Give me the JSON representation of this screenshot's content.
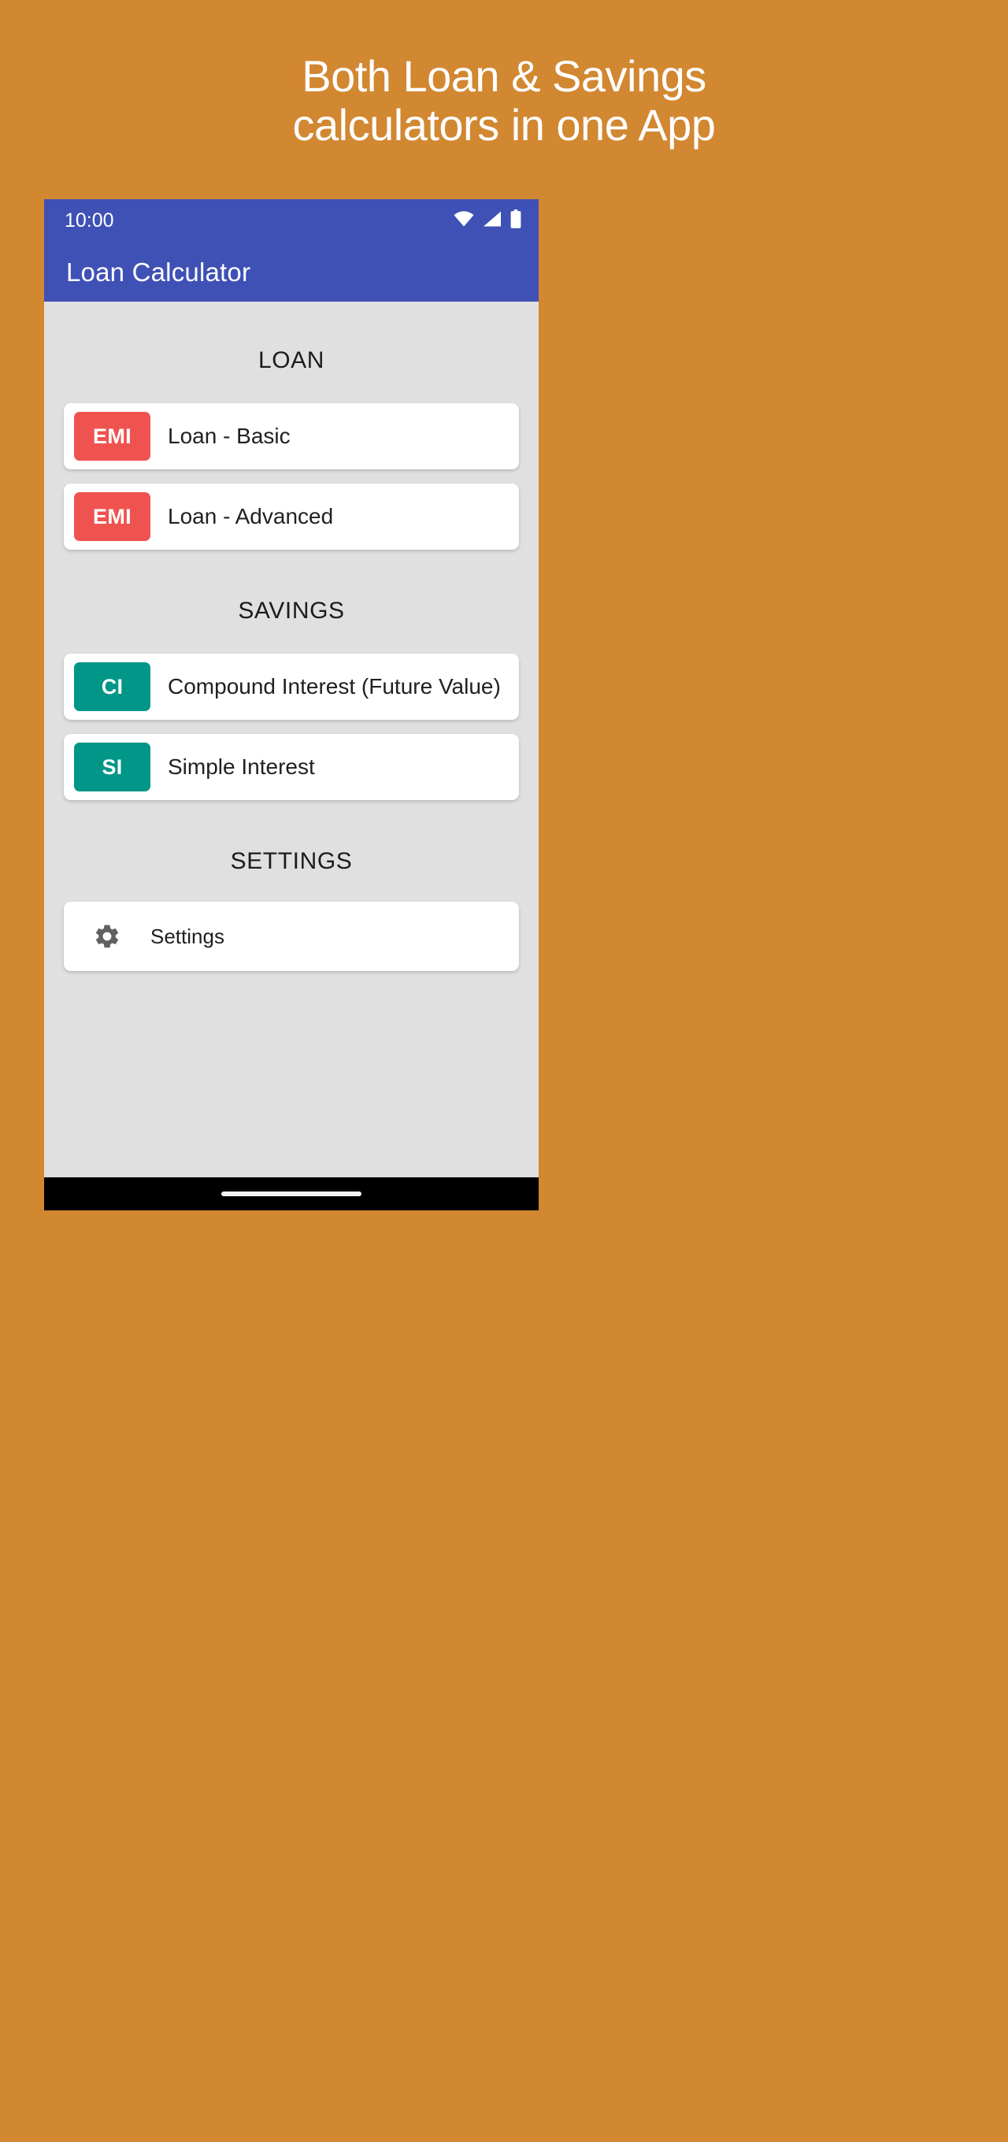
{
  "promo": {
    "line1": "Both Loan & Savings",
    "line2": "calculators in one App",
    "background_color": "#d28731",
    "text_color": "#ffffff"
  },
  "phone": {
    "status_bar": {
      "clock": "10:00",
      "background_color": "#3f51b5",
      "icons": [
        "wifi-icon",
        "signal-icon",
        "battery-icon"
      ]
    },
    "app_bar": {
      "title": "Loan Calculator",
      "background_color": "#3f51b5"
    },
    "nav_bar": {
      "gesture_pill": ""
    }
  },
  "sections": [
    {
      "header": "LOAN",
      "items": [
        {
          "badge": "EMI",
          "badge_color": "#ef5350",
          "label": "Loan - Basic"
        },
        {
          "badge": "EMI",
          "badge_color": "#ef5350",
          "label": "Loan - Advanced"
        }
      ]
    },
    {
      "header": "SAVINGS",
      "items": [
        {
          "badge": "CI",
          "badge_color": "#009688",
          "label": "Compound Interest (Future Value)"
        },
        {
          "badge": "SI",
          "badge_color": "#009688",
          "label": "Simple Interest"
        }
      ]
    },
    {
      "header": "SETTINGS",
      "items": [
        {
          "badge": "gear-icon",
          "badge_color": "#616161",
          "label": "Settings"
        }
      ]
    }
  ]
}
